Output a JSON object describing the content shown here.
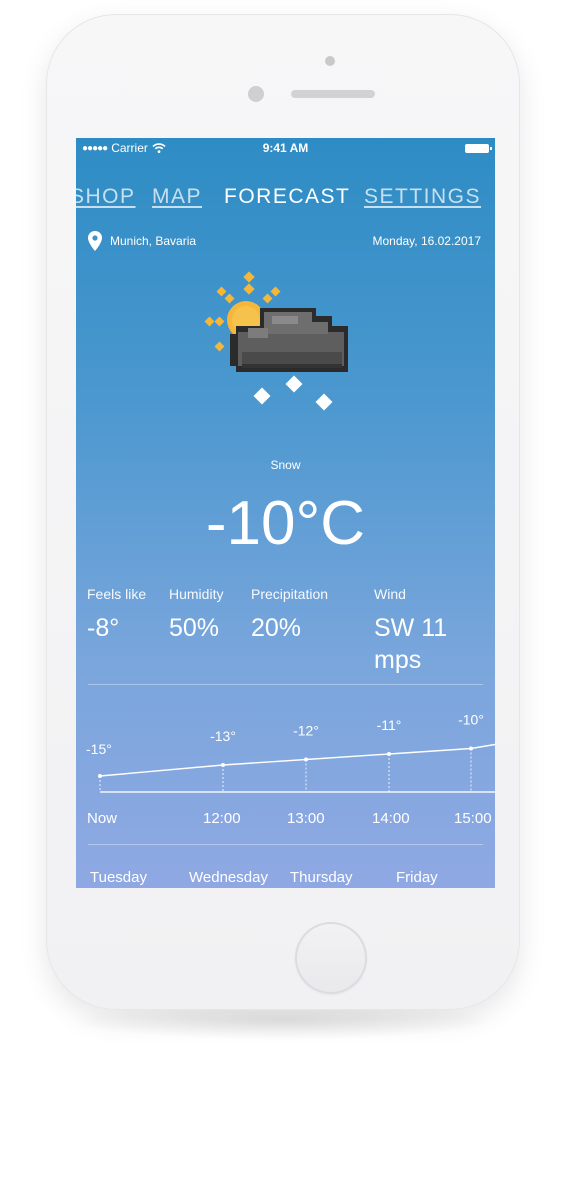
{
  "status_bar": {
    "carrier": "Carrier",
    "time": "9:41 AM"
  },
  "nav": {
    "shop": "SHOP",
    "map": "MAP",
    "forecast": "FORECAST",
    "settings": "SETTINGS",
    "active": "FORECAST"
  },
  "location": {
    "place": "Munich, Bavaria",
    "date": "Monday, 16.02.2017"
  },
  "current": {
    "condition": "Snow",
    "temperature": "-10°C",
    "icon": "sun-behind-cloud-with-snow-icon"
  },
  "metrics": [
    {
      "label": "Feels like",
      "value": "-8°"
    },
    {
      "label": "Humidity",
      "value": "50%"
    },
    {
      "label": "Precipitation",
      "value": "20%"
    },
    {
      "label": "Wind",
      "value": "SW 11 mps"
    }
  ],
  "chart_data": {
    "type": "line",
    "x": [
      "Now",
      "12:00",
      "13:00",
      "14:00",
      "15:00"
    ],
    "values": [
      -15,
      -13,
      -12,
      -11,
      -10
    ],
    "point_labels": [
      "-15°",
      "-13°",
      "-12°",
      "-11°",
      "-10°"
    ]
  },
  "days": [
    "Tuesday",
    "Wednesday",
    "Thursday",
    "Friday"
  ],
  "colors": {
    "sky_top": "#2e8cc4",
    "sky_bottom": "#8fa8e3",
    "sun": "#f4b73a",
    "cloud": "#6b6b6b"
  }
}
